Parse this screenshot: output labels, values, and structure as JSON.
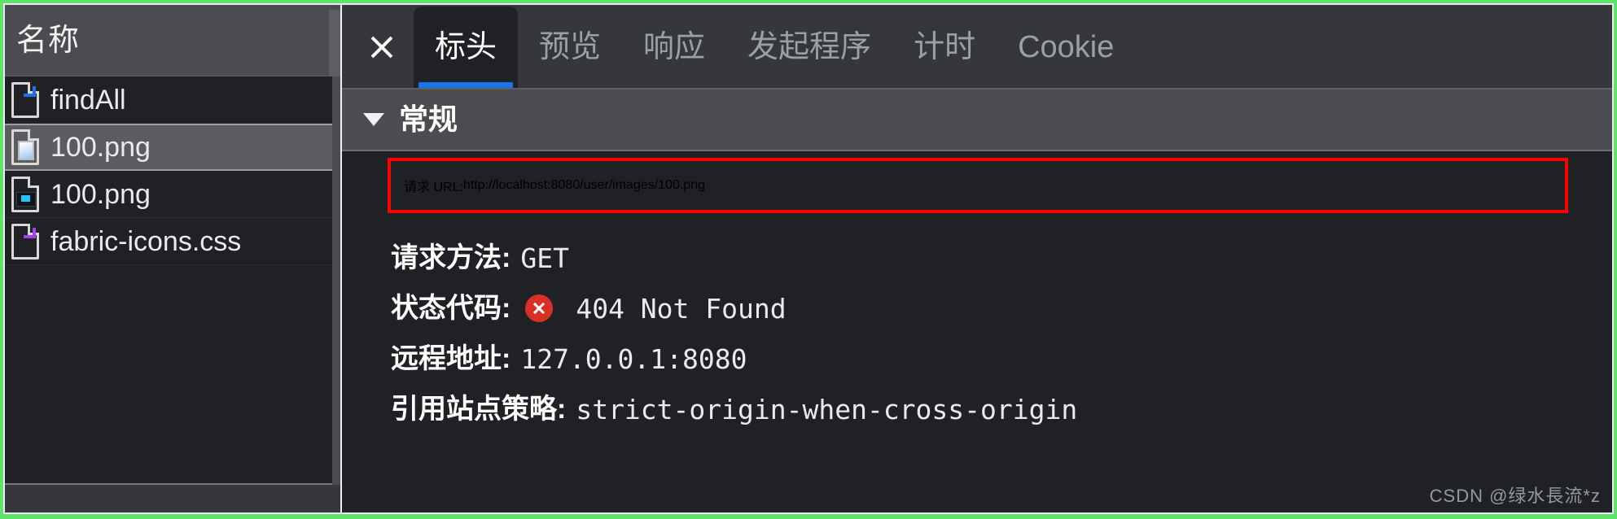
{
  "left_panel": {
    "column_header": "名称",
    "requests": [
      {
        "name": "findAll",
        "icon": "document-file-icon",
        "badge": "doc",
        "selected": false
      },
      {
        "name": "100.png",
        "icon": "image-file-icon",
        "badge": "img",
        "selected": true
      },
      {
        "name": "100.png",
        "icon": "image-file-icon",
        "badge": "screen",
        "selected": false
      },
      {
        "name": "fabric-icons.css",
        "icon": "stylesheet-file-icon",
        "badge": "css",
        "selected": false
      }
    ]
  },
  "tabbar": {
    "close_icon": "close-icon",
    "tabs": [
      {
        "label": "标头",
        "active": true
      },
      {
        "label": "预览",
        "active": false
      },
      {
        "label": "响应",
        "active": false
      },
      {
        "label": "发起程序",
        "active": false
      },
      {
        "label": "计时",
        "active": false
      },
      {
        "label": "Cookie",
        "active": false
      }
    ]
  },
  "section": {
    "title": "常规",
    "expanded": true
  },
  "details": {
    "url": {
      "key": "请求 URL:",
      "value": "http://localhost:8080/user/images/100.png",
      "highlighted": true,
      "highlight_color": "#ff0000"
    },
    "method": {
      "key": "请求方法:",
      "value": "GET"
    },
    "status": {
      "key": "状态代码:",
      "value": "404 Not Found",
      "badge_icon": "error-circle-icon",
      "badge_color": "#d93025"
    },
    "remote_address": {
      "key": "远程地址:",
      "value": "127.0.0.1:8080"
    },
    "referrer_policy": {
      "key": "引用站点策略:",
      "value": "strict-origin-when-cross-origin"
    }
  },
  "watermark": {
    "text": "CSDN @绿水長流*z"
  },
  "colors": {
    "accent_blue": "#1a73e8",
    "capture_border_green": "#5fe36a",
    "panel_bg": "#202124",
    "header_bg": "#4a4c4f",
    "selected_row": "#5a5c5f",
    "error_red": "#d93025",
    "highlight_red": "#ff0000"
  }
}
